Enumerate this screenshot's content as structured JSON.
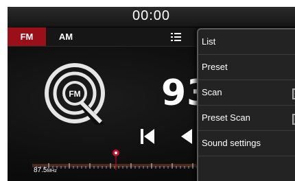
{
  "status_bar": {
    "time": "00:00"
  },
  "band_tabs": {
    "fm": "FM",
    "am": "AM"
  },
  "logo": {
    "text": "FM"
  },
  "frequency": {
    "display": "93"
  },
  "tuner": {
    "value": "87.5",
    "unit": "MHz"
  },
  "menu": {
    "items": [
      {
        "label": "List"
      },
      {
        "label": "Preset"
      },
      {
        "label": "Scan"
      },
      {
        "label": "Preset Scan"
      },
      {
        "label": "Sound settings"
      }
    ]
  },
  "colors": {
    "accent": "#9b1018",
    "marker": "#c8102e",
    "background": "#0e0e0e",
    "menu_bg": "#232323"
  }
}
